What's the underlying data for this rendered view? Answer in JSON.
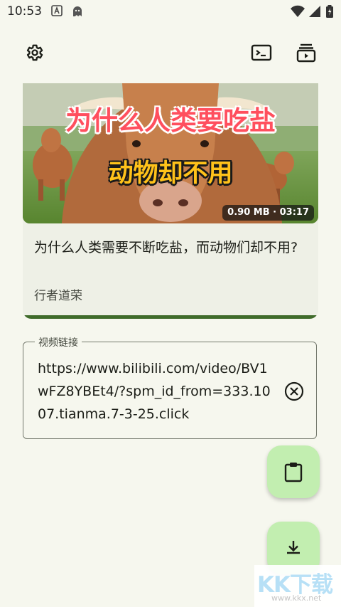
{
  "status_bar": {
    "time": "10:53",
    "icons": [
      "a-notification-icon",
      "ghost-notification-icon",
      "wifi-icon",
      "signal-icon",
      "battery-icon"
    ]
  },
  "toolbar": {
    "settings_icon": "gear-icon",
    "terminal_icon": "terminal-icon",
    "queue_icon": "queue-icon"
  },
  "video": {
    "thumbnail_title_1": "为什么人类要吃盐",
    "thumbnail_title_2": "动物却不用",
    "size": "0.90 MB",
    "duration": "03:17",
    "meta": "0.90 MB · 03:17",
    "title": "为什么人类需要不断吃盐，而动物们却不用?",
    "author": "行者道荣",
    "progress": 1.0
  },
  "url_field": {
    "label": "视频链接",
    "value": "https://www.bilibili.com/video/BV1wFZ8YBEt4/?spm_id_from=333.1007.tianma.7-3-25.click",
    "clear_icon": "clear-circle-icon"
  },
  "fabs": {
    "paste_icon": "clipboard-icon",
    "download_icon": "download-icon"
  },
  "watermark": {
    "text": "KK下载",
    "sub": "www.kkx.net"
  },
  "colors": {
    "background": "#f6f7ee",
    "fab": "#c2eeb0",
    "progress": "#3f6b2a",
    "title_red": "#ff4f5e",
    "title_yellow": "#ffc21a"
  }
}
